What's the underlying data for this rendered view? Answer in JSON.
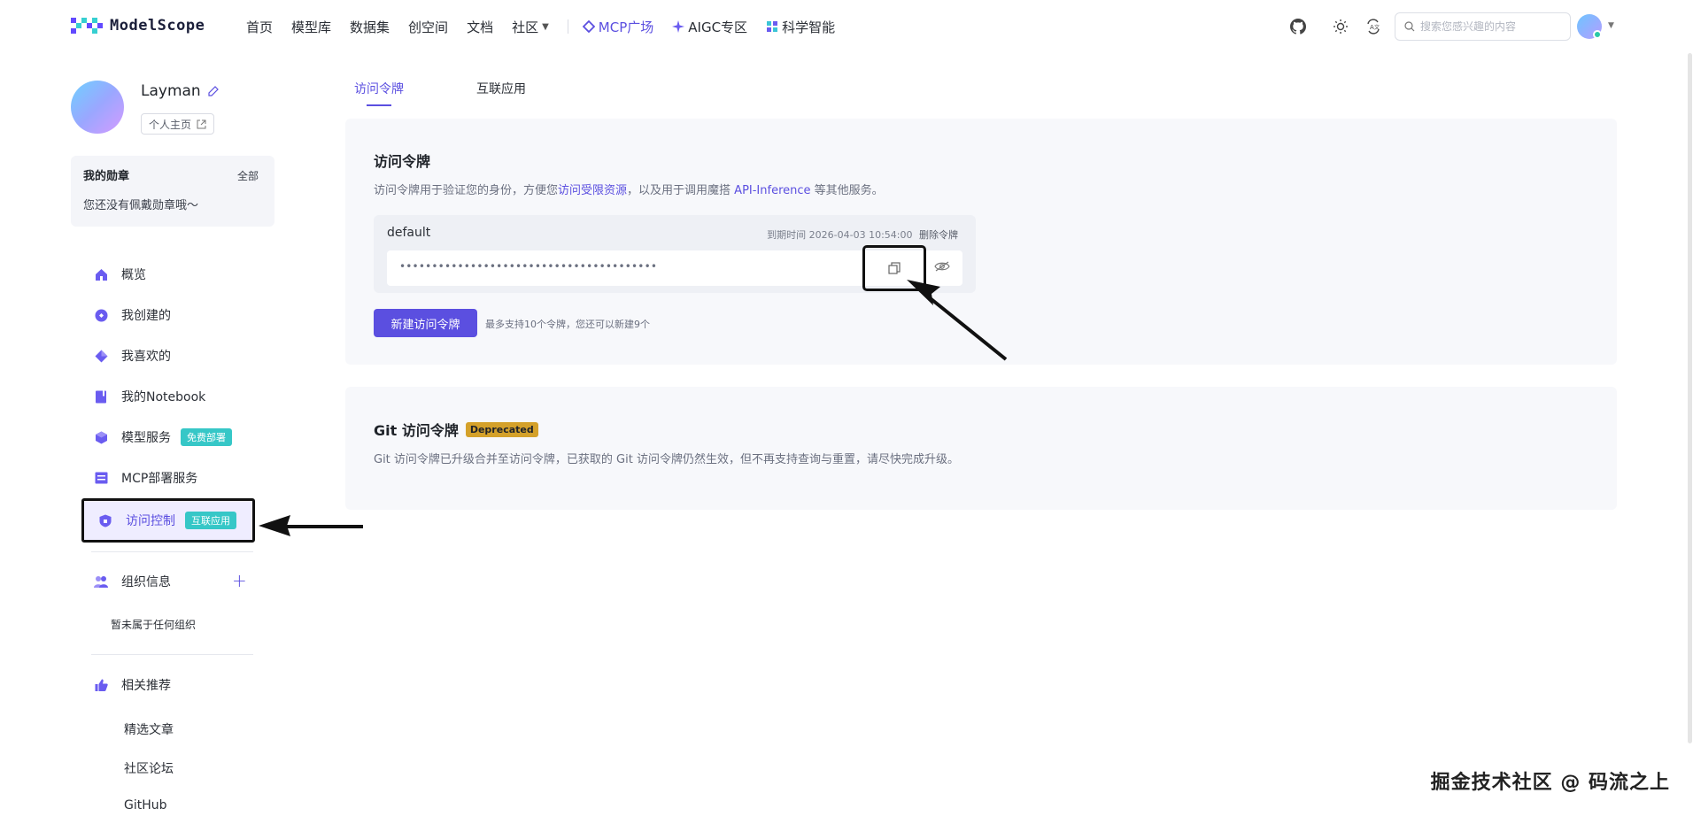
{
  "header": {
    "logo_text": "ModelScope",
    "nav": [
      {
        "label": "首页"
      },
      {
        "label": "模型库"
      },
      {
        "label": "数据集"
      },
      {
        "label": "创空间"
      },
      {
        "label": "文档"
      },
      {
        "label": "社区"
      }
    ],
    "nav_special": [
      {
        "label": "MCP广场"
      },
      {
        "label": "AIGC专区"
      },
      {
        "label": "科学智能"
      }
    ],
    "search_placeholder": "搜索您感兴趣的内容"
  },
  "profile": {
    "name": "Layman",
    "homepage_label": "个人主页"
  },
  "badges": {
    "title": "我的勋章",
    "all_label": "全部",
    "empty_text": "您还没有佩戴勋章哦～"
  },
  "sidebar": {
    "items": [
      {
        "label": "概览",
        "icon": "home-icon"
      },
      {
        "label": "我创建的",
        "icon": "create-icon"
      },
      {
        "label": "我喜欢的",
        "icon": "diamond-icon"
      },
      {
        "label": "我的Notebook",
        "icon": "notebook-icon"
      },
      {
        "label": "模型服务",
        "icon": "cube-icon",
        "tag": "免费部署"
      },
      {
        "label": "MCP部署服务",
        "icon": "server-icon"
      },
      {
        "label": "访问控制",
        "icon": "shield-icon",
        "tag": "互联应用"
      }
    ],
    "org": {
      "label": "组织信息",
      "empty_text": "暂未属于任何组织"
    },
    "recommend": {
      "label": "相关推荐",
      "links": [
        "精选文章",
        "社区论坛",
        "GitHub"
      ]
    }
  },
  "tabs": [
    {
      "label": "访问令牌",
      "active": true
    },
    {
      "label": "互联应用",
      "active": false
    }
  ],
  "access_token": {
    "title": "访问令牌",
    "desc_prefix": "访问令牌用于验证您的身份，方便您",
    "desc_link1": "访问受限资源",
    "desc_mid": "，以及用于调用魔搭 ",
    "desc_link2": "API-Inference",
    "desc_suffix": " 等其他服务。",
    "token": {
      "name": "default",
      "expire_label": "到期时间",
      "expire_value": "2026-04-03 10:54:00",
      "delete_label": "删除令牌",
      "masked_value": "••••••••••••••••••••••••••••••••••••••••"
    },
    "new_button": "新建访问令牌",
    "limit_note": "最多支持10个令牌，您还可以新建9个"
  },
  "git_token": {
    "title": "Git 访问令牌",
    "badge": "Deprecated",
    "desc": "Git 访问令牌已升级合并至访问令牌，已获取的 Git 访问令牌仍然生效，但不再支持查询与重置，请尽快完成升级。"
  },
  "watermark": "掘金技术社区 @ 码流之上",
  "colors": {
    "accent": "#5b4fe0",
    "tag_green": "#36c7c7",
    "deprecated": "#d4a12a"
  }
}
